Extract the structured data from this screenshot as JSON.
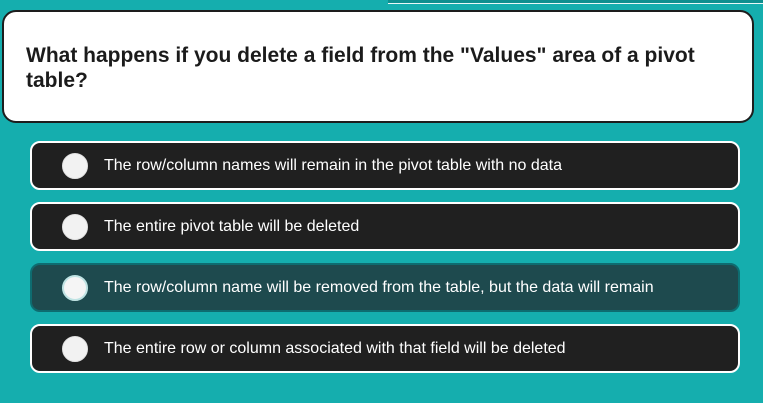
{
  "question": {
    "text": "What happens if you delete a field from the \"Values\" area of a pivot table?"
  },
  "answers": [
    {
      "label": "The row/column names will remain in the pivot table with no data",
      "selected": false
    },
    {
      "label": "The entire pivot table will be deleted",
      "selected": false
    },
    {
      "label": "The row/column name will be removed from the table, but the data will remain",
      "selected": true
    },
    {
      "label": "The entire row or column associated with that field will be deleted",
      "selected": false
    }
  ],
  "colors": {
    "background": "#15aeae",
    "question_card": "#ffffff",
    "answer_bg": "#202020",
    "selected_answer_bg": "#1e4a4e",
    "text_on_dark": "#ffffff"
  }
}
